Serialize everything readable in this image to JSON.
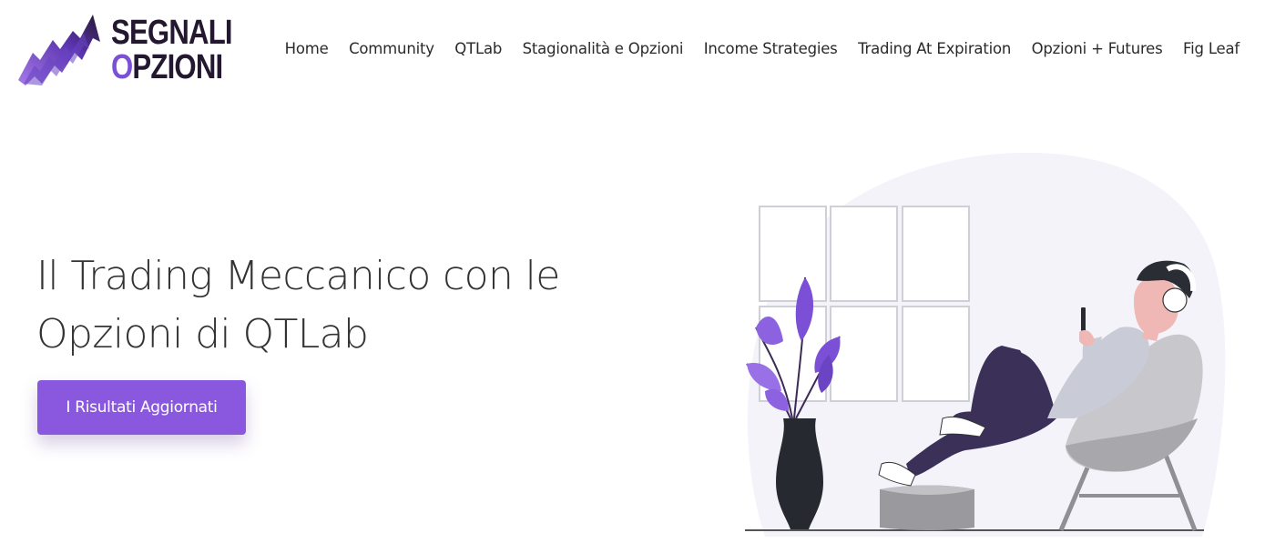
{
  "brand": {
    "line1": "SEGNALI",
    "line2_initial": "O",
    "line2_rest": "PZIONI",
    "colors": {
      "purple": "#7b4fd6",
      "dark": "#23182f"
    }
  },
  "nav": {
    "items": [
      {
        "label": "Home"
      },
      {
        "label": "Community"
      },
      {
        "label": "QTLab"
      },
      {
        "label": "Stagionalità e Opzioni"
      },
      {
        "label": "Income Strategies"
      },
      {
        "label": "Trading At Expiration"
      },
      {
        "label": "Opzioni + Futures"
      },
      {
        "label": "Fig Leaf"
      }
    ]
  },
  "hero": {
    "title_line1": "Il Trading Meccanico con le",
    "title_line2": "Opzioni di QTLab",
    "cta_label": "I Risultati Aggiornati",
    "accent_color": "#8a58df"
  },
  "illustration": {
    "icons": [
      "window-icon",
      "plant-vase-icon",
      "person-chair-icon",
      "headphones-icon",
      "smartphone-icon"
    ]
  }
}
